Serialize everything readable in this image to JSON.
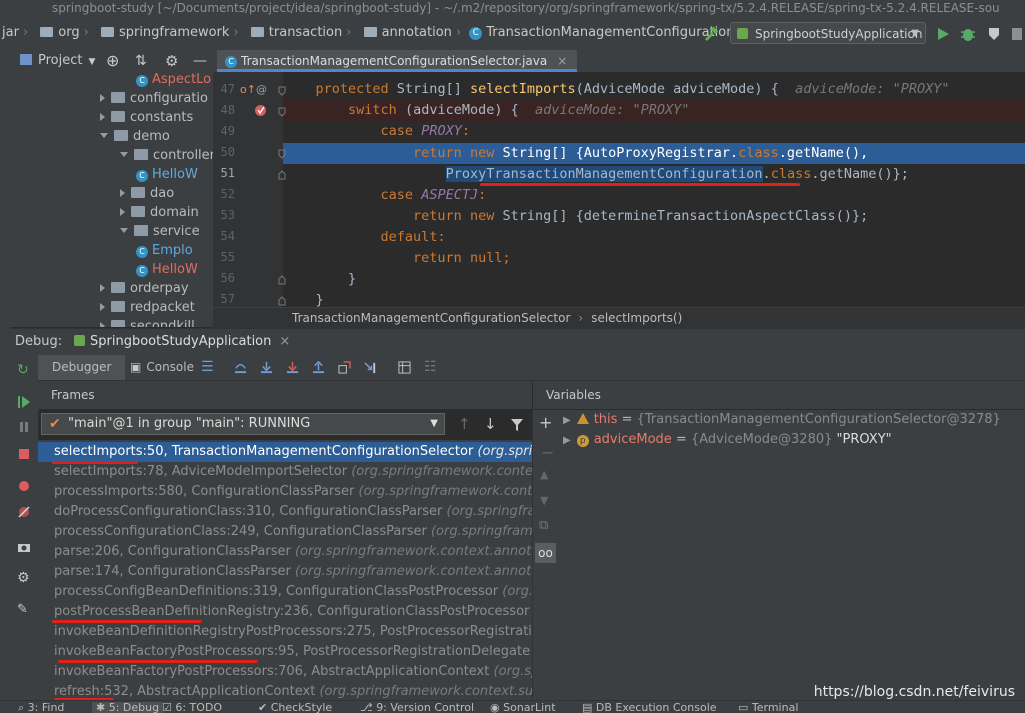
{
  "title_bar": "springboot-study [~/Documents/project/idea/springboot-study] - ~/.m2/repository/org/springframework/spring-tx/5.2.4.RELEASE/spring-tx-5.2.4.RELEASE-sou",
  "nav": {
    "first": "jar",
    "items": [
      "org",
      "springframework",
      "transaction",
      "annotation"
    ],
    "current": "TransactionManagementConfigurationSelector",
    "run_config": "SpringbootStudyApplication"
  },
  "project": {
    "header": "Project",
    "tree": [
      {
        "label": "AspectLo",
        "type": "class",
        "level": 3,
        "expand": "none",
        "color": "#e26b5b"
      },
      {
        "label": "configuratio",
        "type": "folder",
        "level": 1,
        "expand": "closed"
      },
      {
        "label": "constants",
        "type": "folder",
        "level": 1,
        "expand": "closed"
      },
      {
        "label": "demo",
        "type": "folder",
        "level": 1,
        "expand": "open"
      },
      {
        "label": "controller",
        "type": "folder",
        "level": 2,
        "expand": "open"
      },
      {
        "label": "HelloW",
        "type": "class",
        "level": 3,
        "expand": "none",
        "color": "#5fa9e0"
      },
      {
        "label": "dao",
        "type": "folder",
        "level": 2,
        "expand": "closed"
      },
      {
        "label": "domain",
        "type": "folder",
        "level": 2,
        "expand": "closed"
      },
      {
        "label": "service",
        "type": "folder",
        "level": 2,
        "expand": "open"
      },
      {
        "label": "Emplo",
        "type": "class",
        "level": 3,
        "expand": "none",
        "color": "#5fa9e0"
      },
      {
        "label": "HelloW",
        "type": "class",
        "level": 3,
        "expand": "none",
        "color": "#e26b5b"
      },
      {
        "label": "orderpay",
        "type": "folder",
        "level": 1,
        "expand": "closed"
      },
      {
        "label": "redpacket",
        "type": "folder",
        "level": 1,
        "expand": "closed"
      },
      {
        "label": "secondkill",
        "type": "folder",
        "level": 1,
        "expand": "closed"
      }
    ]
  },
  "editor": {
    "tab": "TransactionManagementConfigurationSelector.java",
    "line_numbers": [
      "47",
      "48",
      "49",
      "50",
      "51",
      "52",
      "53",
      "54",
      "55",
      "56",
      "57"
    ],
    "line47": {
      "kw1": "protected",
      "t1": " String[] ",
      "fn": "selectImports",
      "t2": "(AdviceMode adviceMode) {",
      "hint": "adviceMode: \"PROXY\""
    },
    "line48": {
      "kw": "switch",
      "t": " (adviceMode) {",
      "hint": "adviceMode: \"PROXY\""
    },
    "line49": {
      "kw": "case ",
      "it": "PROXY",
      "t": ":"
    },
    "line50": {
      "kw1": "return new ",
      "t1": "String[] {AutoProxyRegistrar.",
      "kw2": "class",
      "t2": ".getName(),"
    },
    "line51": {
      "t1": "ProxyTransactionManagementConfiguration",
      "t2": ".",
      "kw": "class",
      "t3": ".getName()};"
    },
    "line52": {
      "kw": "case ",
      "it": "ASPECTJ",
      "t": ":"
    },
    "line53": {
      "kw": "return new ",
      "t": "String[] {determineTransactionAspectClass()};"
    },
    "line54": {
      "kw": "default",
      "t": ":"
    },
    "line55": {
      "kw": "return null",
      "t": ";"
    },
    "line56": {
      "t": "}"
    },
    "line57": {
      "t": "}"
    },
    "breadcrumb": [
      "TransactionManagementConfigurationSelector",
      "selectImports()"
    ]
  },
  "debug": {
    "label": "Debug:",
    "session": "SpringbootStudyApplication",
    "tabs": [
      "Debugger",
      "Console"
    ],
    "frames_title": "Frames",
    "variables_title": "Variables",
    "thread": "\"main\"@1 in group \"main\": RUNNING",
    "frames": [
      {
        "m": "selectImports:50, TransactionManagementConfigurationSelector",
        "p": "(org.springfra"
      },
      {
        "m": "selectImports:78, AdviceModeImportSelector",
        "p": "(org.springframework.context.an"
      },
      {
        "m": "processImports:580, ConfigurationClassParser",
        "p": "(org.springframework.context"
      },
      {
        "m": "doProcessConfigurationClass:310, ConfigurationClassParser",
        "p": "(org.springframew"
      },
      {
        "m": "processConfigurationClass:249, ConfigurationClassParser",
        "p": "(org.springframew"
      },
      {
        "m": "parse:206, ConfigurationClassParser",
        "p": "(org.springframework.context.annotatio"
      },
      {
        "m": "parse:174, ConfigurationClassParser",
        "p": "(org.springframework.context.annotatio"
      },
      {
        "m": "processConfigBeanDefinitions:319, ConfigurationClassPostProcessor",
        "p": "(org.sp"
      },
      {
        "m": "postProcessBeanDefinitionRegistry:236, ConfigurationClassPostProcessor",
        "p": "(o"
      },
      {
        "m": "invokeBeanDefinitionRegistryPostProcessors:275, PostProcessorRegistrationI",
        "p": ""
      },
      {
        "m": "invokeBeanFactoryPostProcessors:95, PostProcessorRegistrationDelegate",
        "p": "(o"
      },
      {
        "m": "invokeBeanFactoryPostProcessors:706, AbstractApplicationContext",
        "p": "(org.spri"
      },
      {
        "m": "refresh:532, AbstractApplicationContext",
        "p": "(org.springframework.context.supp"
      }
    ],
    "variables": [
      {
        "name": "this",
        "value": "{TransactionManagementConfigurationSelector@3278}",
        "extra": ""
      },
      {
        "name": "adviceMode",
        "value": "{AdviceMode@3280}",
        "extra": "\"PROXY\""
      }
    ],
    "var_separator": " = "
  },
  "bottom_tabs": [
    "3: Find",
    "5: Debug",
    "6: TODO",
    "CheckStyle",
    "9: Version Control",
    "SonarLint",
    "DB Execution Console",
    "Terminal"
  ],
  "watermark": "https://blog.csdn.net/feivirus",
  "colors": {
    "accent": "#2d5d97",
    "underline": "#e0201a"
  }
}
